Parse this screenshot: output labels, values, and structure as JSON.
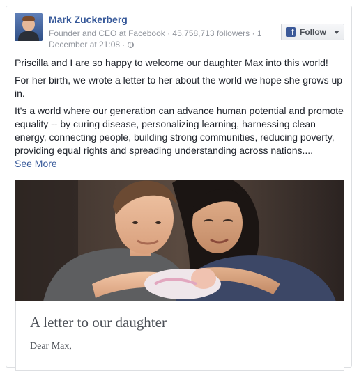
{
  "post": {
    "author": "Mark Zuckerberg",
    "meta": "Founder and CEO at Facebook · 45,758,713 followers · 1 December at 21:08 ·",
    "privacy_icon": "globe-icon",
    "follow_label": "Follow",
    "follow_icon": "facebook-f-icon",
    "follow_icon_glyph": "f",
    "paragraphs": [
      "Priscilla and I are so happy to welcome our daughter Max into this world!",
      "For her birth, we wrote a letter to her about the world we hope she grows up in.",
      "It's a world where our generation can advance human potential and promote equality -- by curing disease, personalizing learning, harnessing clean energy, connecting people, building strong communities, reducing poverty, providing equal rights and spreading understanding across nations...."
    ],
    "see_more": "See More"
  },
  "link_preview": {
    "title": "A letter to our daughter",
    "excerpt": "Dear Max,"
  },
  "colors": {
    "link_blue": "#365899",
    "facebook_blue": "#3b5998",
    "meta_gray": "#90949c",
    "text": "#1d2129"
  }
}
